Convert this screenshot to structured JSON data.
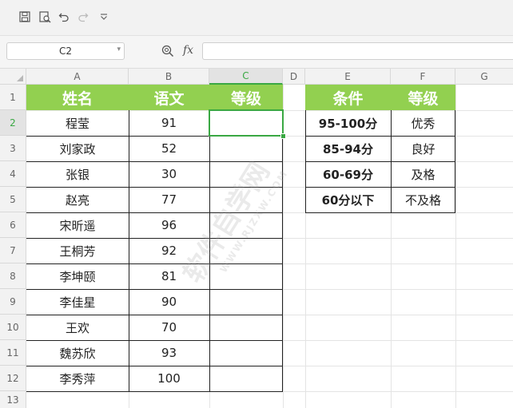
{
  "toolbar": {
    "icons": [
      "save-icon",
      "print-preview-icon",
      "undo-icon",
      "redo-icon",
      "customize-dropdown-icon"
    ]
  },
  "formula_bar": {
    "name_box": "C2",
    "fx_label": "fx",
    "formula": ""
  },
  "sheet": {
    "columns": [
      "A",
      "B",
      "C",
      "D",
      "E",
      "F",
      "G"
    ],
    "rows": [
      "1",
      "2",
      "3",
      "4",
      "5",
      "6",
      "7",
      "8",
      "9",
      "10",
      "11",
      "12",
      "13"
    ],
    "selected_cell": "C2",
    "header_color": "#92d050",
    "selection_color": "#3aa843",
    "main_table": {
      "headers": [
        "姓名",
        "语文",
        "等级"
      ],
      "rows": [
        [
          "程莹",
          "91",
          ""
        ],
        [
          "刘家政",
          "52",
          ""
        ],
        [
          "张银",
          "30",
          ""
        ],
        [
          "赵亮",
          "77",
          ""
        ],
        [
          "宋昕遥",
          "96",
          ""
        ],
        [
          "王桐芳",
          "92",
          ""
        ],
        [
          "李坤颐",
          "81",
          ""
        ],
        [
          "李佳星",
          "90",
          ""
        ],
        [
          "王欢",
          "70",
          ""
        ],
        [
          "魏苏欣",
          "93",
          ""
        ],
        [
          "李秀萍",
          "100",
          ""
        ]
      ]
    },
    "lookup_table": {
      "headers": [
        "条件",
        "等级"
      ],
      "rows": [
        [
          "95-100分",
          "优秀"
        ],
        [
          "85-94分",
          "良好"
        ],
        [
          "60-69分",
          "及格"
        ],
        [
          "60分以下",
          "不及格"
        ]
      ]
    }
  },
  "watermark": {
    "text": "软件自学网",
    "url": "WWW.RJZXW.COM"
  }
}
